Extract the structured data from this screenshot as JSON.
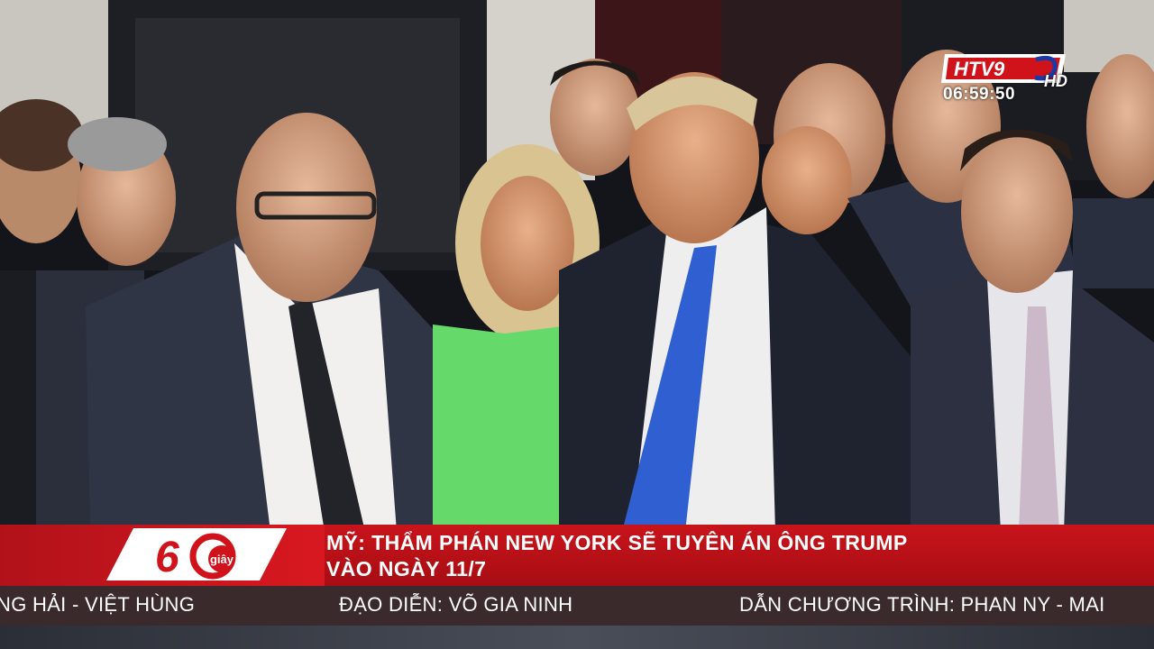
{
  "channel": {
    "logo_text": "HTV9",
    "hd_label": "HD",
    "clock": "06:59:50"
  },
  "program": {
    "badge_number": "60",
    "badge_unit": "giây"
  },
  "headline": {
    "line1": "MỸ: THẨM PHÁN NEW YORK SẼ TUYÊN ÁN ÔNG TRUMP",
    "line2": "VÀO NGÀY 11/7"
  },
  "ticker": {
    "items": [
      "NG HẢI - VIỆT HÙNG",
      "ĐẠO DIỄN: VÕ GIA NINH",
      "DẪN CHƯƠNG TRÌNH: PHAN NY - MAI"
    ]
  },
  "colors": {
    "banner_red": "#c8141b",
    "ticker_bg": "#3a2a2c"
  }
}
